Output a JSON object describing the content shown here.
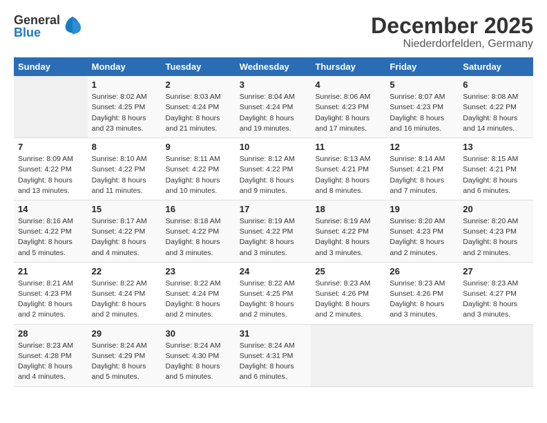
{
  "logo": {
    "general": "General",
    "blue": "Blue"
  },
  "header": {
    "month": "December 2025",
    "location": "Niederdorfelden, Germany"
  },
  "weekdays": [
    "Sunday",
    "Monday",
    "Tuesday",
    "Wednesday",
    "Thursday",
    "Friday",
    "Saturday"
  ],
  "weeks": [
    [
      {
        "day": "",
        "empty": true
      },
      {
        "day": "1",
        "sunrise": "8:02 AM",
        "sunset": "4:25 PM",
        "daylight": "8 hours and 23 minutes."
      },
      {
        "day": "2",
        "sunrise": "8:03 AM",
        "sunset": "4:24 PM",
        "daylight": "8 hours and 21 minutes."
      },
      {
        "day": "3",
        "sunrise": "8:04 AM",
        "sunset": "4:24 PM",
        "daylight": "8 hours and 19 minutes."
      },
      {
        "day": "4",
        "sunrise": "8:06 AM",
        "sunset": "4:23 PM",
        "daylight": "8 hours and 17 minutes."
      },
      {
        "day": "5",
        "sunrise": "8:07 AM",
        "sunset": "4:23 PM",
        "daylight": "8 hours and 16 minutes."
      },
      {
        "day": "6",
        "sunrise": "8:08 AM",
        "sunset": "4:22 PM",
        "daylight": "8 hours and 14 minutes."
      }
    ],
    [
      {
        "day": "7",
        "sunrise": "8:09 AM",
        "sunset": "4:22 PM",
        "daylight": "8 hours and 13 minutes."
      },
      {
        "day": "8",
        "sunrise": "8:10 AM",
        "sunset": "4:22 PM",
        "daylight": "8 hours and 11 minutes."
      },
      {
        "day": "9",
        "sunrise": "8:11 AM",
        "sunset": "4:22 PM",
        "daylight": "8 hours and 10 minutes."
      },
      {
        "day": "10",
        "sunrise": "8:12 AM",
        "sunset": "4:22 PM",
        "daylight": "8 hours and 9 minutes."
      },
      {
        "day": "11",
        "sunrise": "8:13 AM",
        "sunset": "4:21 PM",
        "daylight": "8 hours and 8 minutes."
      },
      {
        "day": "12",
        "sunrise": "8:14 AM",
        "sunset": "4:21 PM",
        "daylight": "8 hours and 7 minutes."
      },
      {
        "day": "13",
        "sunrise": "8:15 AM",
        "sunset": "4:21 PM",
        "daylight": "8 hours and 6 minutes."
      }
    ],
    [
      {
        "day": "14",
        "sunrise": "8:16 AM",
        "sunset": "4:22 PM",
        "daylight": "8 hours and 5 minutes."
      },
      {
        "day": "15",
        "sunrise": "8:17 AM",
        "sunset": "4:22 PM",
        "daylight": "8 hours and 4 minutes."
      },
      {
        "day": "16",
        "sunrise": "8:18 AM",
        "sunset": "4:22 PM",
        "daylight": "8 hours and 3 minutes."
      },
      {
        "day": "17",
        "sunrise": "8:19 AM",
        "sunset": "4:22 PM",
        "daylight": "8 hours and 3 minutes."
      },
      {
        "day": "18",
        "sunrise": "8:19 AM",
        "sunset": "4:22 PM",
        "daylight": "8 hours and 3 minutes."
      },
      {
        "day": "19",
        "sunrise": "8:20 AM",
        "sunset": "4:23 PM",
        "daylight": "8 hours and 2 minutes."
      },
      {
        "day": "20",
        "sunrise": "8:20 AM",
        "sunset": "4:23 PM",
        "daylight": "8 hours and 2 minutes."
      }
    ],
    [
      {
        "day": "21",
        "sunrise": "8:21 AM",
        "sunset": "4:23 PM",
        "daylight": "8 hours and 2 minutes."
      },
      {
        "day": "22",
        "sunrise": "8:22 AM",
        "sunset": "4:24 PM",
        "daylight": "8 hours and 2 minutes."
      },
      {
        "day": "23",
        "sunrise": "8:22 AM",
        "sunset": "4:24 PM",
        "daylight": "8 hours and 2 minutes."
      },
      {
        "day": "24",
        "sunrise": "8:22 AM",
        "sunset": "4:25 PM",
        "daylight": "8 hours and 2 minutes."
      },
      {
        "day": "25",
        "sunrise": "8:23 AM",
        "sunset": "4:26 PM",
        "daylight": "8 hours and 2 minutes."
      },
      {
        "day": "26",
        "sunrise": "8:23 AM",
        "sunset": "4:26 PM",
        "daylight": "8 hours and 3 minutes."
      },
      {
        "day": "27",
        "sunrise": "8:23 AM",
        "sunset": "4:27 PM",
        "daylight": "8 hours and 3 minutes."
      }
    ],
    [
      {
        "day": "28",
        "sunrise": "8:23 AM",
        "sunset": "4:28 PM",
        "daylight": "8 hours and 4 minutes."
      },
      {
        "day": "29",
        "sunrise": "8:24 AM",
        "sunset": "4:29 PM",
        "daylight": "8 hours and 5 minutes."
      },
      {
        "day": "30",
        "sunrise": "8:24 AM",
        "sunset": "4:30 PM",
        "daylight": "8 hours and 5 minutes."
      },
      {
        "day": "31",
        "sunrise": "8:24 AM",
        "sunset": "4:31 PM",
        "daylight": "8 hours and 6 minutes."
      },
      {
        "day": "",
        "empty": true
      },
      {
        "day": "",
        "empty": true
      },
      {
        "day": "",
        "empty": true
      }
    ]
  ],
  "labels": {
    "sunrise": "Sunrise:",
    "sunset": "Sunset:",
    "daylight": "Daylight:"
  }
}
